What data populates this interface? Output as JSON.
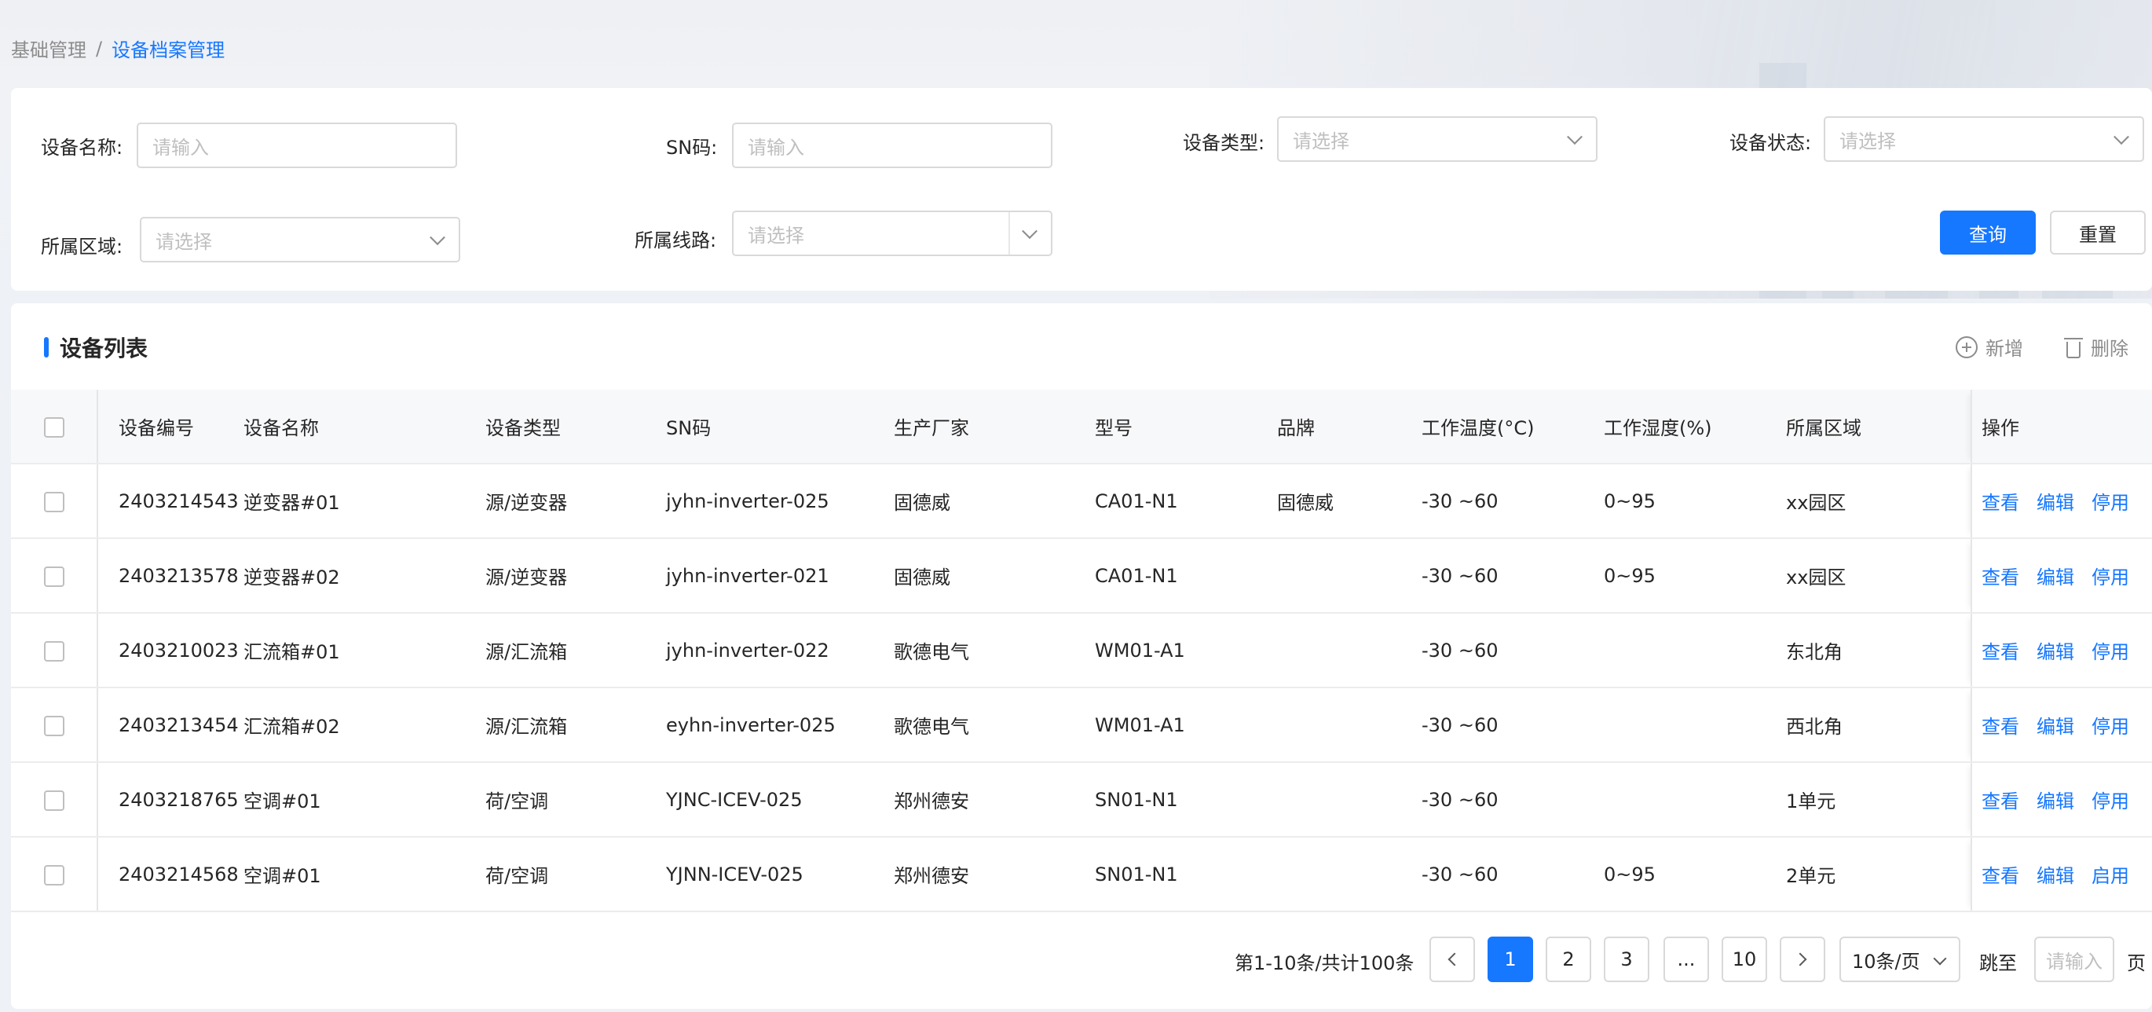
{
  "breadcrumb": {
    "parent": "基础管理",
    "separator": "/",
    "current": "设备档案管理"
  },
  "filters": {
    "device_name": {
      "label": "设备名称:",
      "placeholder": "请输入"
    },
    "sn": {
      "label": "SN码:",
      "placeholder": "请输入"
    },
    "device_type": {
      "label": "设备类型:",
      "placeholder": "请选择"
    },
    "device_status": {
      "label": "设备状态:",
      "placeholder": "请选择"
    },
    "region": {
      "label": "所属区域:",
      "placeholder": "请选择"
    },
    "line": {
      "label": "所属线路:",
      "placeholder": "请选择"
    },
    "query_label": "查询",
    "reset_label": "重置"
  },
  "list": {
    "title": "设备列表",
    "add_label": "新增",
    "delete_label": "删除",
    "columns": [
      "设备编号",
      "设备名称",
      "设备类型",
      "SN码",
      "生产厂家",
      "型号",
      "品牌",
      "工作温度(°C)",
      "工作湿度(%)",
      "所属区域",
      "操作"
    ],
    "rows": [
      {
        "id": "2403214543",
        "name": "逆变器#01",
        "type": "源/逆变器",
        "sn": "jyhn-inverter-025",
        "maker": "固德威",
        "model": "CA01-N1",
        "brand": "固德威",
        "temp": "-30 ~60",
        "humidity": "0~95",
        "region": "xx园区",
        "actions": [
          "查看",
          "编辑",
          "停用"
        ]
      },
      {
        "id": "2403213578",
        "name": "逆变器#02",
        "type": "源/逆变器",
        "sn": "jyhn-inverter-021",
        "maker": "固德威",
        "model": "CA01-N1",
        "brand": "",
        "temp": "-30 ~60",
        "humidity": "0~95",
        "region": "xx园区",
        "actions": [
          "查看",
          "编辑",
          "停用"
        ]
      },
      {
        "id": "2403210023",
        "name": "汇流箱#01",
        "type": "源/汇流箱",
        "sn": "jyhn-inverter-022",
        "maker": "歌德电气",
        "model": "WM01-A1",
        "brand": "",
        "temp": "-30 ~60",
        "humidity": "",
        "region": "东北角",
        "actions": [
          "查看",
          "编辑",
          "停用"
        ]
      },
      {
        "id": "2403213454",
        "name": "汇流箱#02",
        "type": "源/汇流箱",
        "sn": "eyhn-inverter-025",
        "maker": "歌德电气",
        "model": "WM01-A1",
        "brand": "",
        "temp": "-30 ~60",
        "humidity": "",
        "region": "西北角",
        "actions": [
          "查看",
          "编辑",
          "停用"
        ]
      },
      {
        "id": "2403218765",
        "name": "空调#01",
        "type": "荷/空调",
        "sn": "YJNC-ICEV-025",
        "maker": "郑州德安",
        "model": "SN01-N1",
        "brand": "",
        "temp": "-30 ~60",
        "humidity": "",
        "region": "1单元",
        "actions": [
          "查看",
          "编辑",
          "停用"
        ]
      },
      {
        "id": "2403214568",
        "name": "空调#01",
        "type": "荷/空调",
        "sn": "YJNN-ICEV-025",
        "maker": "郑州德安",
        "model": "SN01-N1",
        "brand": "",
        "temp": "-30 ~60",
        "humidity": "0~95",
        "region": "2单元",
        "actions": [
          "查看",
          "编辑",
          "启用"
        ]
      }
    ]
  },
  "pagination": {
    "summary": "第1-10条/共计100条",
    "pages": [
      "1",
      "2",
      "3",
      "...",
      "10"
    ],
    "active_page": "1",
    "page_size": "10条/页",
    "jump_label": "跳至",
    "jump_placeholder": "请输入",
    "page_unit": "页"
  },
  "colors": {
    "primary": "#1677ff",
    "border": "#d9d9d9",
    "placeholder": "#bfbfbf"
  }
}
